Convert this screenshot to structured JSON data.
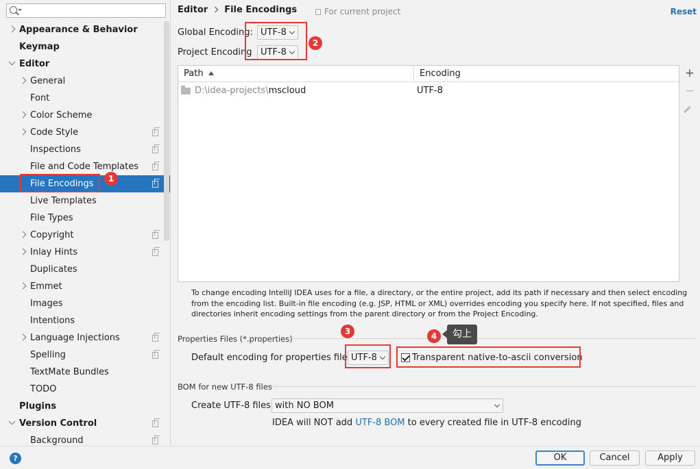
{
  "sidebar": {
    "items": [
      {
        "label": "Appearance & Behavior",
        "bold": true,
        "indent": 1,
        "arrow": "right"
      },
      {
        "label": "Keymap",
        "bold": true,
        "indent": 1
      },
      {
        "label": "Editor",
        "bold": true,
        "indent": 1,
        "arrow": "down"
      },
      {
        "label": "General",
        "indent": 2,
        "arrow": "right"
      },
      {
        "label": "Font",
        "indent": 2
      },
      {
        "label": "Color Scheme",
        "indent": 2,
        "arrow": "right"
      },
      {
        "label": "Code Style",
        "indent": 2,
        "arrow": "right",
        "copy": true
      },
      {
        "label": "Inspections",
        "indent": 2,
        "copy": true
      },
      {
        "label": "File and Code Templates",
        "indent": 2,
        "copy": true
      },
      {
        "label": "File Encodings",
        "indent": 2,
        "copy": true,
        "selected": true
      },
      {
        "label": "Live Templates",
        "indent": 2
      },
      {
        "label": "File Types",
        "indent": 2
      },
      {
        "label": "Copyright",
        "indent": 2,
        "arrow": "right",
        "copy": true
      },
      {
        "label": "Inlay Hints",
        "indent": 2,
        "arrow": "right",
        "copy": true
      },
      {
        "label": "Duplicates",
        "indent": 2
      },
      {
        "label": "Emmet",
        "indent": 2,
        "arrow": "right"
      },
      {
        "label": "Images",
        "indent": 2
      },
      {
        "label": "Intentions",
        "indent": 2
      },
      {
        "label": "Language Injections",
        "indent": 2,
        "arrow": "right",
        "copy": true
      },
      {
        "label": "Spelling",
        "indent": 2,
        "copy": true
      },
      {
        "label": "TextMate Bundles",
        "indent": 2
      },
      {
        "label": "TODO",
        "indent": 2
      },
      {
        "label": "Plugins",
        "bold": true,
        "indent": 1
      },
      {
        "label": "Version Control",
        "bold": true,
        "indent": 1,
        "arrow": "down",
        "copy": true
      },
      {
        "label": "Background",
        "indent": 2,
        "copy": true
      }
    ]
  },
  "header": {
    "crumb_parent": "Editor",
    "crumb_current": "File Encodings",
    "for_current_project": "For current project",
    "reset": "Reset"
  },
  "encoding": {
    "global_label": "Global Encoding:",
    "global_value": "UTF-8",
    "project_label": "Project Encoding",
    "project_value": "UTF-8"
  },
  "table": {
    "col_path": "Path",
    "col_encoding": "Encoding",
    "rows": [
      {
        "path_prefix": "D:\\idea-projects\\",
        "path_name": "mscloud",
        "encoding": "UTF-8"
      }
    ],
    "add": "+",
    "remove": "−"
  },
  "help_text": "To change encoding IntelliJ IDEA uses for a file, a directory, or the entire project, add its path if necessary and then select encoding from the encoding list. Built-in file encoding (e.g. JSP, HTML or XML) overrides encoding you specify here. If not specified, files and directories inherit encoding settings from the parent directory or from the Project Encoding.",
  "properties": {
    "section": "Properties Files (*.properties)",
    "default_label": "Default encoding for properties files:",
    "default_value": "UTF-8",
    "transparent_label": "Transparent native-to-ascii conversion",
    "transparent_checked": true
  },
  "bom": {
    "section": "BOM for new UTF-8 files",
    "create_label": "Create UTF-8 files:",
    "create_value": "with NO BOM",
    "note_prefix": "IDEA will NOT add ",
    "note_link": "UTF-8 BOM",
    "note_suffix": " to every created file in UTF-8 encoding"
  },
  "annotations": {
    "badge1": "1",
    "badge2": "2",
    "badge3": "3",
    "badge4": "4",
    "tooltip": "勾上",
    "color": "#e53935"
  },
  "footer": {
    "help": "?",
    "ok": "OK",
    "cancel": "Cancel",
    "apply": "Apply"
  }
}
